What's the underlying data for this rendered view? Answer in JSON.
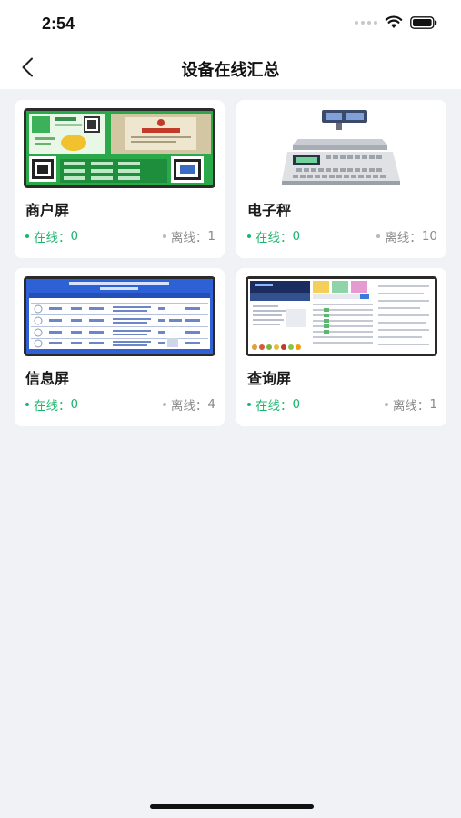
{
  "status_bar": {
    "time": "2:54"
  },
  "header": {
    "title": "设备在线汇总"
  },
  "devices": [
    {
      "name": "商户屏",
      "online_label": "在线：",
      "online_count": "0",
      "offline_label": "离线：",
      "offline_count": "1"
    },
    {
      "name": "电子秤",
      "online_label": "在线：",
      "online_count": "0",
      "offline_label": "离线：",
      "offline_count": "10"
    },
    {
      "name": "信息屏",
      "online_label": "在线：",
      "online_count": "0",
      "offline_label": "离线：",
      "offline_count": "4"
    },
    {
      "name": "查询屏",
      "online_label": "在线：",
      "online_count": "0",
      "offline_label": "离线：",
      "offline_count": "1"
    }
  ],
  "colors": {
    "online": "#1cb56c",
    "offline": "#8a8a8a",
    "background": "#f1f2f5",
    "card": "#ffffff"
  }
}
